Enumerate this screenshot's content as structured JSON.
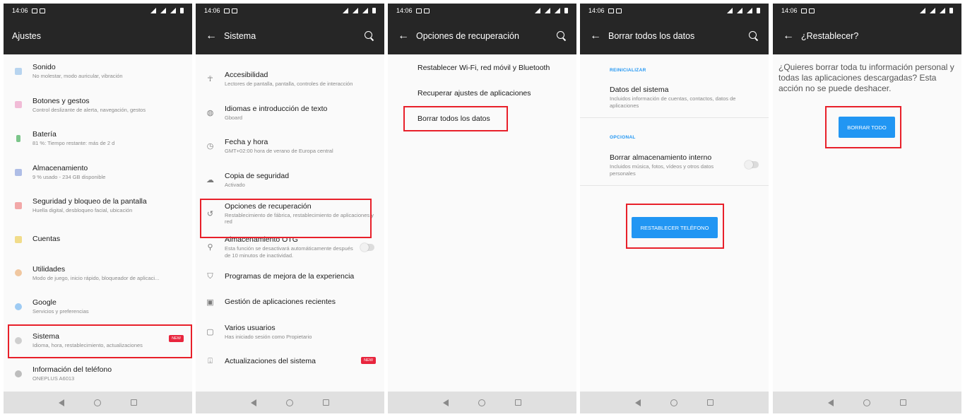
{
  "status_time": "14:06",
  "accent": "#2196f3",
  "highlight": "#e8202a",
  "screens": [
    {
      "title": "Ajustes",
      "items": [
        {
          "t1": "Sonido",
          "t2": "No molestar, modo auricular, vibración",
          "icon": "volume-icon"
        },
        {
          "t1": "Botones y gestos",
          "t2": "Control deslizante de alerta, navegación, gestos",
          "icon": "buttons-icon"
        },
        {
          "t1": "Batería",
          "t2": "81 %: Tiempo restante: más de 2 d",
          "icon": "battery-icon"
        },
        {
          "t1": "Almacenamiento",
          "t2": "9 % usado - 234 GB disponible",
          "icon": "storage-icon"
        },
        {
          "t1": "Seguridad y bloqueo de la pantalla",
          "t2": "Huella digital, desbloqueo facial, ubicación",
          "icon": "lock-icon"
        },
        {
          "t1": "Cuentas",
          "t2": "",
          "icon": "accounts-icon"
        },
        {
          "t1": "Utilidades",
          "t2": "Modo de juego, inicio rápido, bloqueador de aplicaci...",
          "icon": "utilities-icon"
        },
        {
          "t1": "Google",
          "t2": "Servicios y preferencias",
          "icon": "google-icon"
        },
        {
          "t1": "Sistema",
          "t2": "Idioma, hora, restablecimiento, actualizaciones",
          "icon": "gear-icon",
          "badge": "NEW"
        },
        {
          "t1": "Información del teléfono",
          "t2": "ONEPLUS A6013",
          "icon": "info-icon"
        }
      ]
    },
    {
      "title": "Sistema",
      "items": [
        {
          "t1": "Accesibilidad",
          "t2": "Lectores de pantalla, pantalla, controles de interacción",
          "icon": "accessibility-icon"
        },
        {
          "t1": "Idiomas e introducción de texto",
          "t2": "Gboard",
          "icon": "globe-icon"
        },
        {
          "t1": "Fecha y hora",
          "t2": "GMT+02:00 hora de verano de Europa central",
          "icon": "clock-icon"
        },
        {
          "t1": "Copia de seguridad",
          "t2": "Activado",
          "icon": "cloud-icon"
        },
        {
          "t1": "Opciones de recuperación",
          "t2": "Restablecimiento de fábrica, restablecimiento de aplicaciones y red",
          "icon": "restore-icon"
        },
        {
          "t1": "Almacenamiento OTG",
          "t2": "Esta función se desactivará automáticamente después de 10 minutos de inactividad.",
          "icon": "usb-icon"
        },
        {
          "t1": "Programas de mejora de la experiencia",
          "t2": "",
          "icon": "shield-icon"
        },
        {
          "t1": "Gestión de aplicaciones recientes",
          "t2": "",
          "icon": "recent-apps-icon"
        },
        {
          "t1": "Varios usuarios",
          "t2": "Has iniciado sesión como Propietario",
          "icon": "user-icon"
        },
        {
          "t1": "Actualizaciones del sistema",
          "t2": "",
          "icon": "update-icon",
          "badge": "NEW"
        }
      ]
    },
    {
      "title": "Opciones de recuperación",
      "items": [
        "Restablecer Wi-Fi, red móvil y Bluetooth",
        "Recuperar ajustes de aplicaciones",
        "Borrar todos los datos"
      ]
    },
    {
      "title": "Borrar todos los datos",
      "section1": "REINICIALIZAR",
      "item1": {
        "t1": "Datos del sistema",
        "t2": "Incluidos información de cuentas, contactos, datos de aplicaciones"
      },
      "section2": "OPCIONAL",
      "item2": {
        "t1": "Borrar almacenamiento interno",
        "t2": "Incluidos música, fotos, vídeos y otros datos personales"
      },
      "button": "RESTABLECER TELÉFONO"
    },
    {
      "title": "¿Restablecer?",
      "question": "¿Quieres borrar toda tu información personal y todas las aplicaciones descargadas? Esta acción no se puede deshacer.",
      "button": "BORRAR TODO"
    }
  ]
}
